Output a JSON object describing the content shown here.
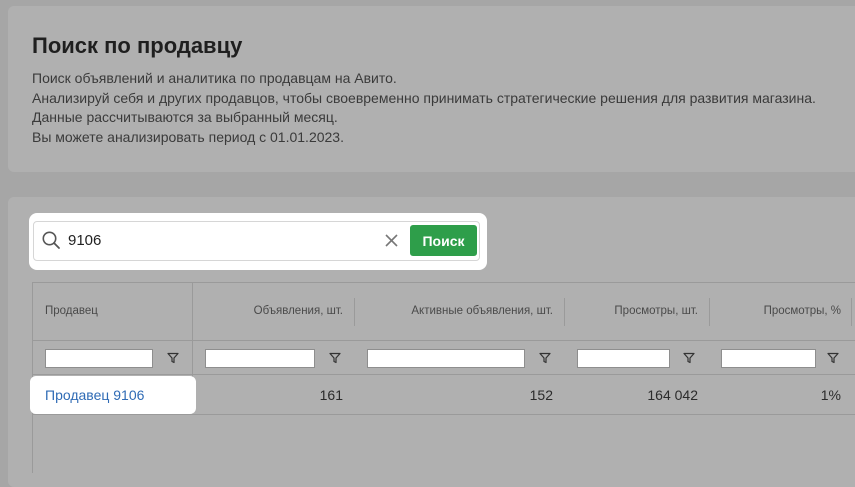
{
  "header": {
    "title": "Поиск по продавцу",
    "description": [
      "Поиск объявлений и аналитика по продавцам на Авито.",
      "Анализируй себя и других продавцов, чтобы своевременно принимать стратегические решения для развития магазина.",
      "Данные рассчитываются за выбранный месяц.",
      "Вы можете анализировать период с 01.01.2023."
    ]
  },
  "search": {
    "value": "9106",
    "button_label": "Поиск",
    "icon": "search-icon",
    "clear_icon": "close-icon"
  },
  "table": {
    "columns": [
      "Продавец",
      "Объявления, шт.",
      "Активные объявления, шт.",
      "Просмотры, шт.",
      "Просмотры, %"
    ],
    "filter_icon": "filter-icon",
    "rows": [
      {
        "seller": "Продавец 9106",
        "listings": "161",
        "active_listings": "152",
        "views": "164 042",
        "views_percent": "1%"
      }
    ]
  },
  "colors": {
    "accent_button": "#2e9e4a",
    "link": "#2f6bb5",
    "overlay": "#a6a6a6"
  }
}
